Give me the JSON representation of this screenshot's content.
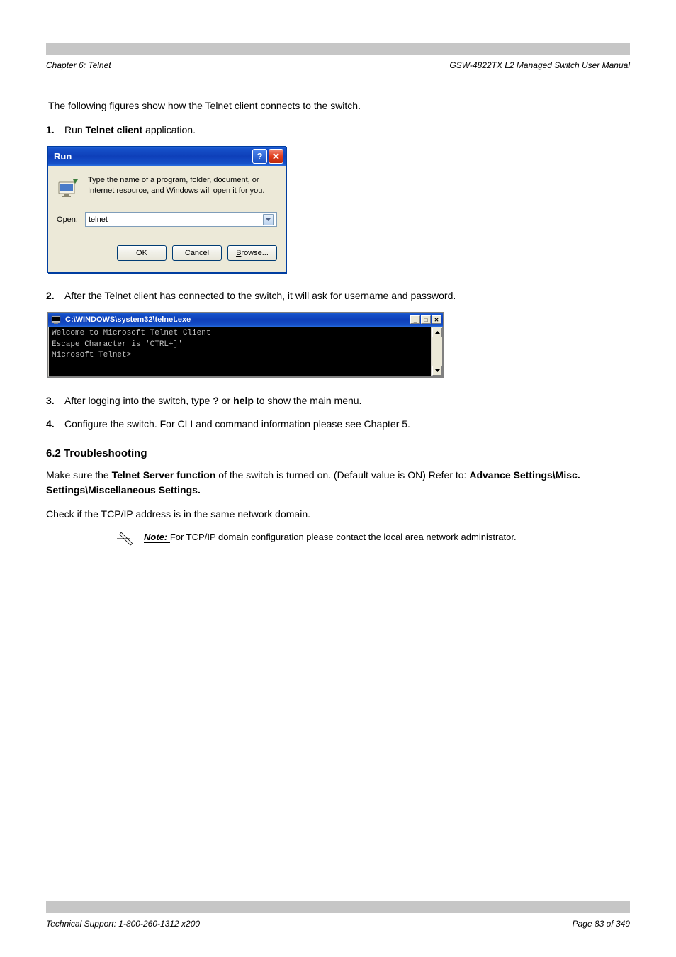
{
  "header": {
    "left": "Chapter 6: Telnet",
    "right": "GSW-4822TX L2 Managed Switch User Manual"
  },
  "intro": "The following figures show how the Telnet client connects to the switch.",
  "step1": {
    "num": "1.",
    "label_prefix": "Run ",
    "label_bold": "Telnet client ",
    "label_rest": "application."
  },
  "run_dialog": {
    "title": "Run",
    "desc": "Type the name of a program, folder, document, or Internet resource, and Windows will open it for you.",
    "open_label": "Open:",
    "open_value": "telnet",
    "buttons": {
      "ok": "OK",
      "cancel": "Cancel",
      "browse": "Browse..."
    }
  },
  "step2": {
    "num": "2.",
    "text": "After the Telnet client has connected to the switch, it will ask for username and password."
  },
  "telnet_window": {
    "title": "C:\\WINDOWS\\system32\\telnet.exe",
    "lines": [
      "Welcome to Microsoft Telnet Client",
      "",
      "Escape Character is 'CTRL+]'",
      "",
      "Microsoft Telnet>"
    ]
  },
  "step3": {
    "num": "3.",
    "prefix": "After logging into the switch, type ",
    "bold1": "?",
    "mid": " or ",
    "bold2": "help",
    "rest": " to show the main menu."
  },
  "step4": {
    "num": "4.",
    "text": "Configure the switch. For CLI and command information please see Chapter 5."
  },
  "trouble": {
    "title": "6.2 Troubleshooting",
    "body1_a": "Make sure the ",
    "body1_b": "Telnet Server function",
    "body1_c": " of the switch is turned on. (Default value is ON) Refer to: ",
    "body1_d": "Advance Settings\\Misc. Settings\\Miscellaneous Settings.",
    "body2": "Check if the TCP/IP address is in the same network domain.",
    "note_prefix": "Note: ",
    "note_text": "For TCP/IP domain configuration please contact the local area network administrator."
  },
  "footer": {
    "left": "Technical Support: 1-800-260-1312 x200",
    "right": "Page 83 of 349"
  }
}
